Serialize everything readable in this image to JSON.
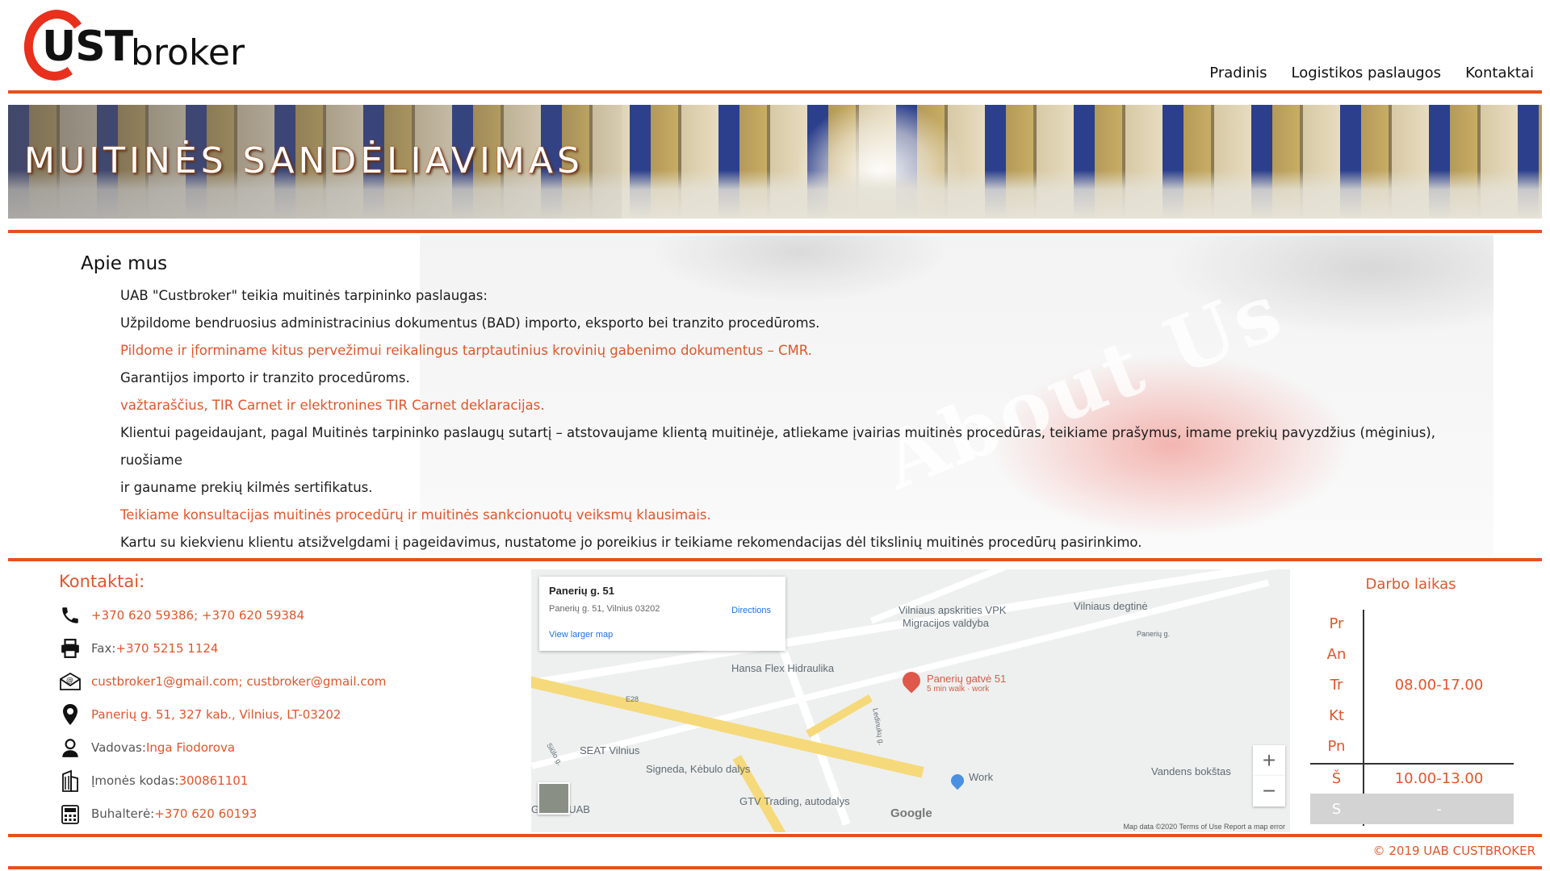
{
  "brand": {
    "logo_initial": "C",
    "logo_ust": "UST",
    "logo_broker": "broker"
  },
  "nav": {
    "items": [
      "Pradinis",
      "Logistikos paslaugos",
      "Kontaktai"
    ]
  },
  "banner": {
    "title": "MUITINĖS SANDĖLIAVIMAS"
  },
  "about": {
    "heading": "Apie mus",
    "watermark": "About Us",
    "lines": [
      {
        "text": "UAB \"Custbroker\" teikia muitinės tarpininko paslaugas:",
        "accent": false
      },
      {
        "text": "Užpildome bendruosius administracinius dokumentus (BAD) importo, eksporto bei tranzito procedūroms.",
        "accent": false
      },
      {
        "text": "Pildome ir įforminame kitus pervežimui reikalingus tarptautinius krovinių gabenimo dokumentus – CMR.",
        "accent": true
      },
      {
        "text": "Garantijos importo ir tranzito procedūroms.",
        "accent": false
      },
      {
        "text": "važtaraščius, TIR Carnet ir elektronines TIR Carnet deklaracijas.",
        "accent": true
      },
      {
        "text": "Klientui pageidaujant, pagal Muitinės tarpininko paslaugų sutartį – atstovaujame klientą muitinėje, atliekame įvairias muitinės procedūras, teikiame prašymus, imame prekių pavyzdžius (mėginius), ruošiame",
        "accent": false
      },
      {
        "text": "ir gauname prekių kilmės sertifikatus.",
        "accent": false
      },
      {
        "text": "Teikiame konsultacijas muitinės procedūrų ir muitinės sankcionuotų veiksmų klausimais.",
        "accent": true
      },
      {
        "text": "Kartu su kiekvienu klientu atsižvelgdami į pageidavimus, nustatome jo poreikius ir teikiame rekomendacijas dėl tikslinių muitinės procedūrų pasirinkimo.",
        "accent": false
      }
    ]
  },
  "contacts": {
    "title": "Kontaktai:",
    "rows": [
      {
        "icon": "phone-icon",
        "label": "",
        "value": "+370 620 59386; +370 620 59384"
      },
      {
        "icon": "fax-icon",
        "label": "Fax: ",
        "value": "+370 5215 1124"
      },
      {
        "icon": "email-icon",
        "label": "",
        "value": "custbroker1@gmail.com; custbroker@gmail.com"
      },
      {
        "icon": "location-pin-icon",
        "label": "",
        "value": "Panerių g. 51, 327 kab., Vilnius, LT-03202"
      },
      {
        "icon": "person-icon",
        "label": "Vadovas:  ",
        "value": "Inga Fiodorova"
      },
      {
        "icon": "building-icon",
        "label": "Įmonės kodas: ",
        "value": "300861101"
      },
      {
        "icon": "calculator-icon",
        "label": "Buhalterė: ",
        "value": "+370 620 60193"
      }
    ]
  },
  "map": {
    "card_title": "Panerių g. 51",
    "card_address": "Panerių g. 51, Vilnius 03202",
    "view_larger": "View larger map",
    "directions": "Directions",
    "pin_label": "Panerių gatvė 51",
    "pin_sub": "5 min walk · work",
    "pois": {
      "vpk": "Vilniaus apskrities VPK",
      "migr": "Migracijos valdyba",
      "degtine": "Vilniaus degtinė",
      "hansa": "Hansa Flex Hidraulika",
      "seat": "SEAT Vilnius",
      "signeda": "Signeda, Kėbulo dalys",
      "gtv": "GTV Trading, autodalys",
      "work": "Work",
      "vandens": "Vandens bokštas",
      "gevara": "Gevara UAB",
      "e28": "E28",
      "paneriu": "Panerių g.",
      "ledinuku": "Ledinukų g.",
      "siuolo": "Siūlo g."
    },
    "google": "Google",
    "credits": "Map data ©2020   Terms of Use   Report a map error",
    "zoom_in": "+",
    "zoom_out": "−"
  },
  "hours": {
    "title": "Darbo laikas",
    "weekdays": [
      "Pr",
      "An",
      "Tr",
      "Kt",
      "Pn"
    ],
    "weekday_time": "08.00-17.00",
    "saturday": "Š",
    "saturday_time": "10.00-13.00",
    "sunday": "S",
    "sunday_time": "-"
  },
  "footer": {
    "copyright": "© 2019 UAB CUSTBROKER"
  },
  "colors": {
    "accent": "#e8501a",
    "text_accent": "#e2552a"
  }
}
